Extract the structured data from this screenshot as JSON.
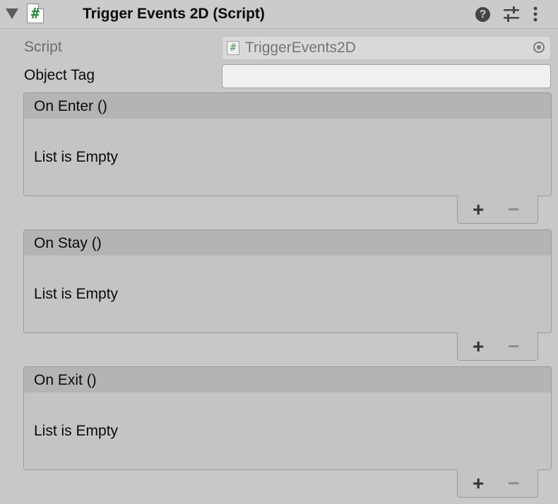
{
  "component": {
    "title": "Trigger Events 2D (Script)",
    "icon": "script-hash-icon"
  },
  "header_icons": [
    "help-icon",
    "settings-sliders-icon",
    "more-vertical-icon"
  ],
  "header": {
    "help_glyph": "?"
  },
  "fields": {
    "script_label": "Script",
    "script_value": "TriggerEvents2D",
    "object_tag_label": "Object Tag",
    "object_tag_value": ""
  },
  "events": [
    {
      "title": "On Enter ()",
      "empty_text": "List is Empty",
      "add_label": "+",
      "remove_label": "−"
    },
    {
      "title": "On Stay ()",
      "empty_text": "List is Empty",
      "add_label": "+",
      "remove_label": "−"
    },
    {
      "title": "On Exit ()",
      "empty_text": "List is Empty",
      "add_label": "+",
      "remove_label": "−"
    }
  ],
  "colors": {
    "background": "#c8c8c8",
    "event_header": "#b4b4b4",
    "script_icon_green": "#2b8a3e"
  }
}
